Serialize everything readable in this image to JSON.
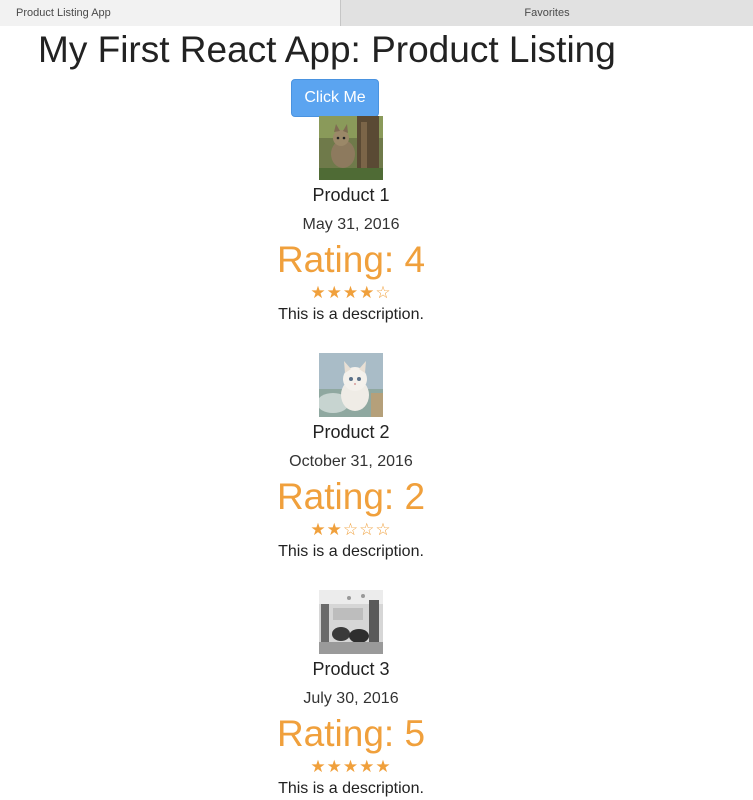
{
  "tabs": {
    "active_label": "Product Listing App",
    "second_label": "Favorites"
  },
  "page": {
    "title": "My First React App: Product Listing",
    "button_label": "Click Me"
  },
  "colors": {
    "accent_orange": "#f0a03c",
    "button_blue": "#5ba4f0"
  },
  "products": [
    {
      "name": "Product 1",
      "date": "May 31, 2016",
      "rating_text": "Rating: 4",
      "rating": 4,
      "stars": "★★★★☆",
      "description": "This is a description.",
      "image": "cat-in-forest"
    },
    {
      "name": "Product 2",
      "date": "October 31, 2016",
      "rating_text": "Rating: 2",
      "rating": 2,
      "stars": "★★☆☆☆",
      "description": "This is a description.",
      "image": "white-kitten"
    },
    {
      "name": "Product 3",
      "date": "July 30, 2016",
      "rating_text": "Rating: 5",
      "rating": 5,
      "stars": "★★★★★",
      "description": "This is a description.",
      "image": "black-white-cafe-photo"
    }
  ]
}
